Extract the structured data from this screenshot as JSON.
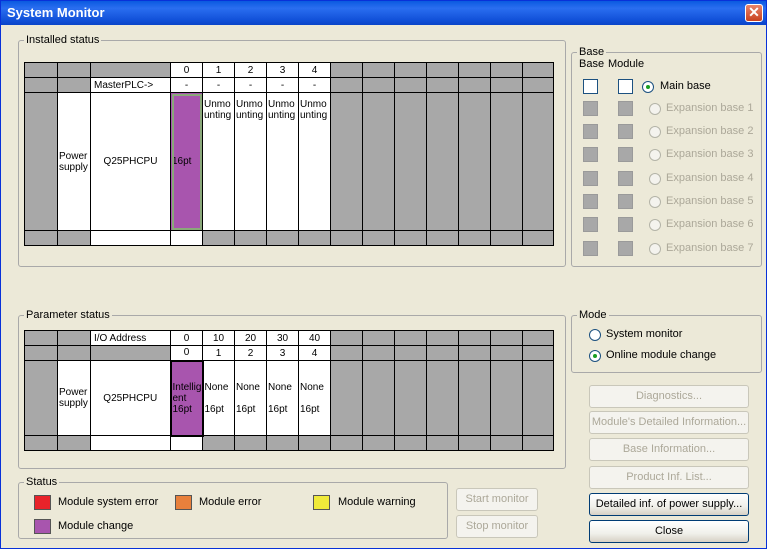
{
  "window": {
    "title": "System Monitor",
    "close_glyph": "✕"
  },
  "installed": {
    "legend": "Installed status",
    "slot_numbers": [
      "0",
      "1",
      "2",
      "3",
      "4"
    ],
    "master_label": "MasterPLC->",
    "master_values": [
      "-",
      "-",
      "-",
      "-",
      "-"
    ],
    "power_supply": "Power supply",
    "cpu": "Q25PHCPU",
    "slots": [
      "16pt",
      "Unmounting",
      "Unmounting",
      "Unmounting",
      "Unmounting"
    ]
  },
  "parameter": {
    "legend": "Parameter status",
    "io_label": "I/O Address",
    "io_values": [
      "0",
      "10",
      "20",
      "30",
      "40"
    ],
    "slot_numbers": [
      "0",
      "1",
      "2",
      "3",
      "4"
    ],
    "power_supply": "Power supply",
    "cpu": "Q25PHCPU",
    "slot_types": [
      "Intelligent",
      "None",
      "None",
      "None",
      "None"
    ],
    "slot_points": [
      "16pt",
      "16pt",
      "16pt",
      "16pt",
      "16pt"
    ]
  },
  "base": {
    "legend": "Base",
    "col_base": "Base",
    "col_module": "Module",
    "options": [
      "Main base",
      "Expansion base 1",
      "Expansion base 2",
      "Expansion base 3",
      "Expansion base 4",
      "Expansion base 5",
      "Expansion base 6",
      "Expansion base 7"
    ],
    "selected": "Main base"
  },
  "mode": {
    "legend": "Mode",
    "options": [
      "System monitor",
      "Online module change"
    ],
    "selected": "Online module change"
  },
  "buttons": {
    "diagnostics": "Diagnostics...",
    "module_detail": "Module's Detailed Information...",
    "base_info": "Base Information...",
    "product_inf": "Product Inf. List...",
    "power_supply_detail": "Detailed inf. of power supply...",
    "close": "Close",
    "start_monitor": "Start monitor",
    "stop_monitor": "Stop monitor"
  },
  "status": {
    "legend": "Status",
    "items": [
      {
        "label": "Module system error",
        "color": "#e8232a"
      },
      {
        "label": "Module error",
        "color": "#e8803c"
      },
      {
        "label": "Module warning",
        "color": "#f0ea3a"
      },
      {
        "label": "Module change",
        "color": "#a855ae"
      }
    ]
  }
}
